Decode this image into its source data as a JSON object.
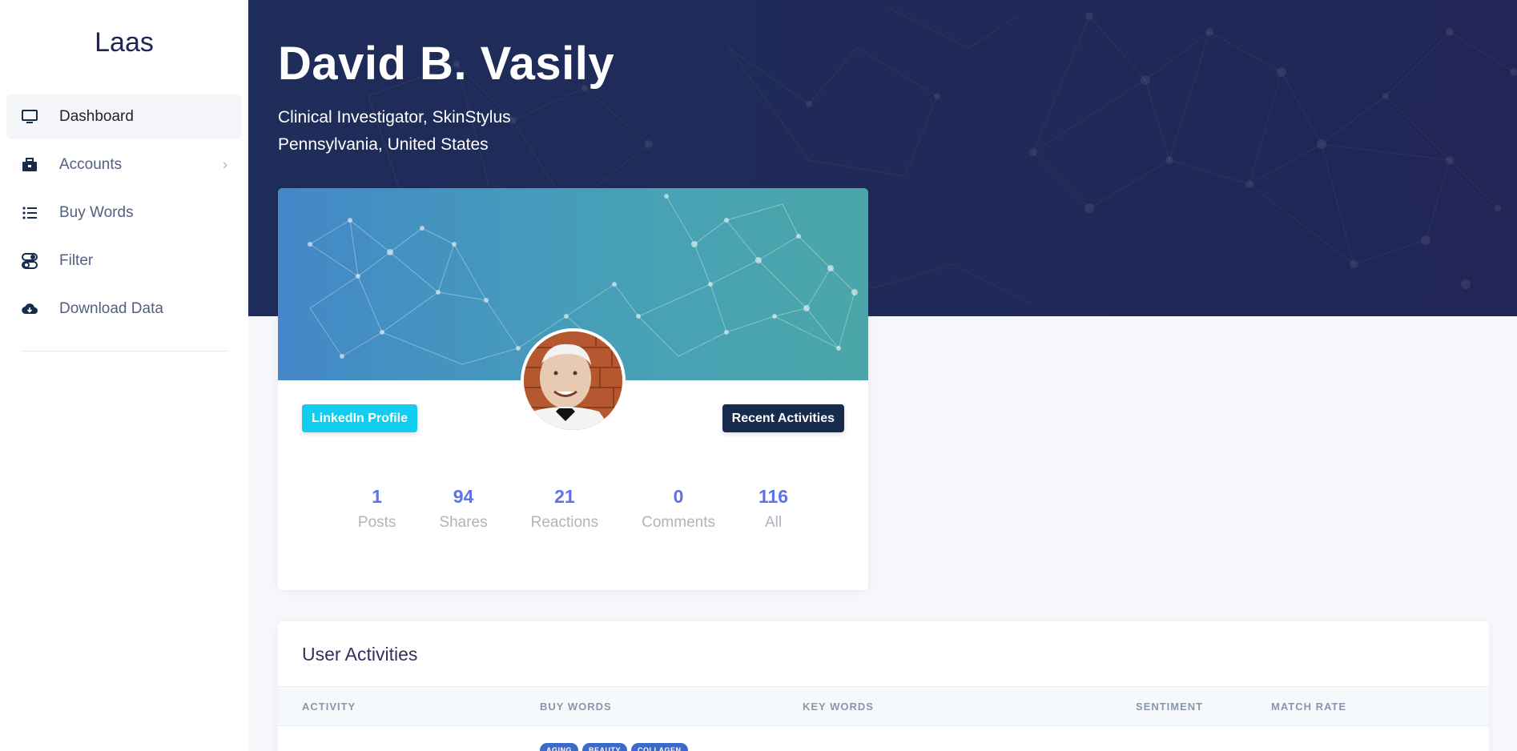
{
  "brand": "Laas",
  "sidebar": {
    "items": [
      {
        "label": "Dashboard",
        "icon": "monitor-icon"
      },
      {
        "label": "Accounts",
        "icon": "briefcase-icon"
      },
      {
        "label": "Buy Words",
        "icon": "list-icon"
      },
      {
        "label": "Filter",
        "icon": "toggle-icon"
      },
      {
        "label": "Download Data",
        "icon": "cloud-download-icon"
      }
    ]
  },
  "profile": {
    "name": "David B. Vasily",
    "title": "Clinical Investigator, SkinStylus",
    "location": "Pennsylvania, United States"
  },
  "card": {
    "linkedin_label": "LinkedIn Profile",
    "recent_label": "Recent Activities",
    "stats": [
      {
        "value": "1",
        "label": "Posts"
      },
      {
        "value": "94",
        "label": "Shares"
      },
      {
        "value": "21",
        "label": "Reactions"
      },
      {
        "value": "0",
        "label": "Comments"
      },
      {
        "value": "116",
        "label": "All"
      }
    ]
  },
  "activities": {
    "title": "User Activities",
    "columns": [
      "ACTIVITY",
      "BUY WORDS",
      "KEY WORDS",
      "SENTIMENT",
      "MATCH RATE"
    ],
    "tags": [
      "AGING",
      "BEAUTY",
      "COLLAGEN"
    ]
  },
  "colors": {
    "header_bg": "#1f2a58",
    "accent": "#5e72e4",
    "linkedin_btn": "#11cdef",
    "dark_btn": "#172b4d"
  }
}
